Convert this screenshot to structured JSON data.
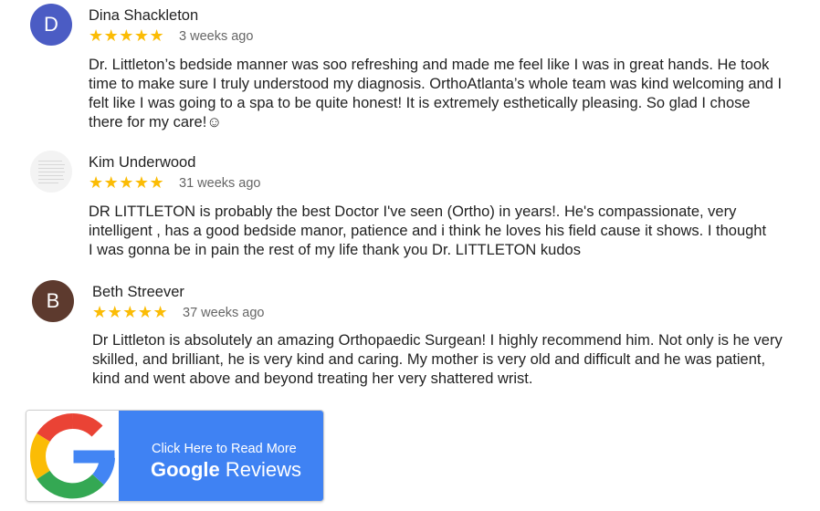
{
  "reviews": [
    {
      "initial": "D",
      "avatar_color": "#4b5cc4",
      "author": "Dina Shackleton",
      "stars": "★★★★★",
      "rating": 5,
      "time": "3 weeks ago",
      "text": "Dr. Littleton’s bedside manner was soo refreshing and made me feel like I was in great hands. He took time to make sure I truly understood my diagnosis. OrthoAtlanta’s whole team was kind welcoming and I felt like I was going to a spa to be quite honest! It is extremely esthetically pleasing. So glad I chose there for my care!☺"
    },
    {
      "initial": "",
      "avatar_color": "#f3f3f3",
      "author": "Kim Underwood",
      "stars": "★★★★★",
      "rating": 5,
      "time": "31 weeks ago",
      "text": "DR LITTLETON is probably the best Doctor I've seen (Ortho) in years!. He's compassionate, very intelligent , has a good bedside manor, patience and i think he loves his field cause it shows. I thought I was gonna be in pain the rest of my life thank you Dr. LITTLETON kudos"
    },
    {
      "initial": "B",
      "avatar_color": "#5d3a2e",
      "author": "Beth Streever",
      "stars": "★★★★★",
      "rating": 5,
      "time": "37 weeks ago",
      "text": "Dr Littleton is absolutely an amazing Orthopaedic Surgean! I highly recommend him. Not only is he very skilled, and brilliant, he is very kind and caring. My mother is very old and difficult and he was patient, kind and went above and beyond treating her very shattered wrist."
    }
  ],
  "google_badge": {
    "line1": "Click Here to Read More",
    "brand": "Google",
    "line2": "Reviews",
    "colors": {
      "blue": "#3f82f3",
      "g_red": "#ea4335",
      "g_yellow": "#fbbc05",
      "g_green": "#34a853",
      "g_blue": "#4285f4"
    }
  }
}
